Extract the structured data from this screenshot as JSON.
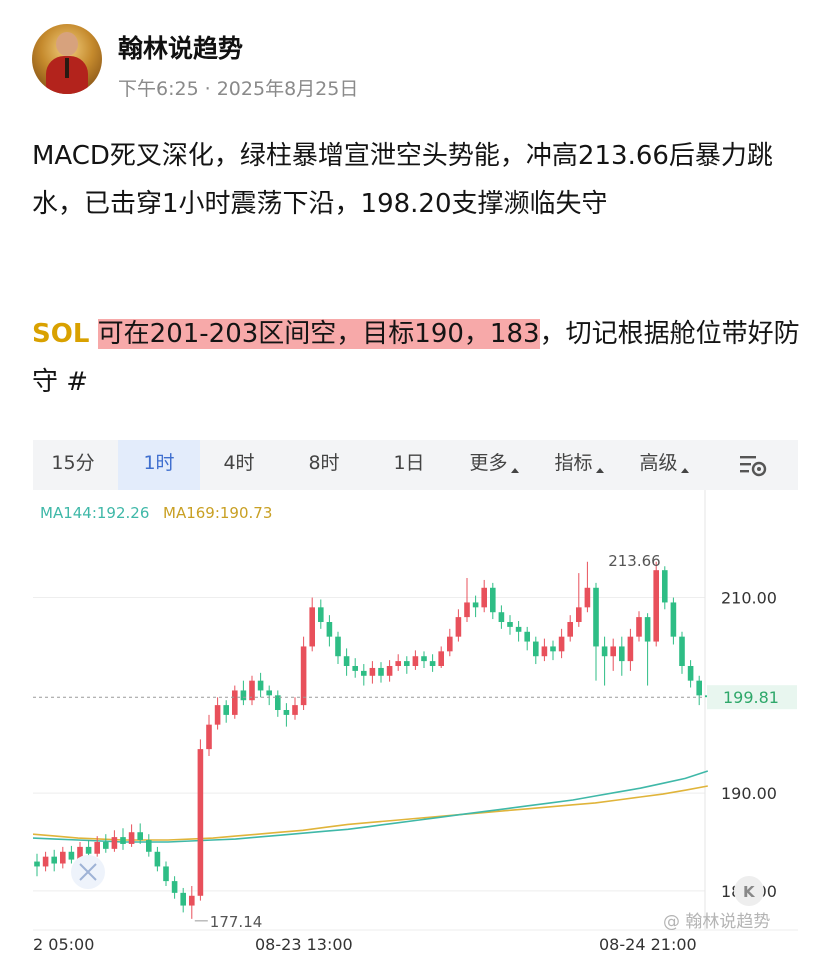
{
  "post": {
    "author": "翰林说趋势",
    "time": "下午6:25",
    "dot": "·",
    "date": "2025年8月25日",
    "paragraph1": "MACD死叉深化，绿柱暴增宣泄空头势能，冲高213.66后暴力跳水，已击穿1小时震荡下沿，198.20支撑濒临失守",
    "symbol": "SOL",
    "highlight": "可在201-203区间空，目标190，183",
    "tail": "，切记根据舱位带好防守 #"
  },
  "chart_tabs": [
    {
      "label": "15分",
      "active": false,
      "dropdown": false
    },
    {
      "label": "1时",
      "active": true,
      "dropdown": false
    },
    {
      "label": "4时",
      "active": false,
      "dropdown": false
    },
    {
      "label": "8时",
      "active": false,
      "dropdown": false
    },
    {
      "label": "1日",
      "active": false,
      "dropdown": false
    },
    {
      "label": "更多",
      "active": false,
      "dropdown": true
    },
    {
      "label": "指标",
      "active": false,
      "dropdown": true
    },
    {
      "label": "高级",
      "active": false,
      "dropdown": true
    }
  ],
  "chart_data": {
    "type": "candlestick",
    "ma_labels": [
      "MA144:192.26",
      "MA169:190.73"
    ],
    "colors": {
      "up": "#e8505b",
      "down": "#2ebd85",
      "ma144": "#3fb8a8",
      "ma169": "#e0b43a"
    },
    "y_ticks": [
      "210.00",
      "190.00",
      "180.00"
    ],
    "y_tick_values": [
      210,
      190,
      180
    ],
    "ylim": [
      176,
      221
    ],
    "current_price": 199.81,
    "current_price_label": "199.81",
    "x_ticks": [
      "2 05:00",
      "08-23 13:00",
      "08-24 21:00"
    ],
    "x_tick_index": [
      2,
      30,
      70
    ],
    "high_label": "213.66",
    "high_index": 72,
    "low_label": "177.14",
    "low_index": 18,
    "candles": [
      [
        183.0,
        182.5,
        183.8,
        181.5
      ],
      [
        182.5,
        183.5,
        184.0,
        182.0
      ],
      [
        183.5,
        182.8,
        184.2,
        182.0
      ],
      [
        182.8,
        184.0,
        184.5,
        182.3
      ],
      [
        184.0,
        183.2,
        184.6,
        182.8
      ],
      [
        183.2,
        184.5,
        185.0,
        182.9
      ],
      [
        184.5,
        183.8,
        185.2,
        183.2
      ],
      [
        183.8,
        185.0,
        185.6,
        183.5
      ],
      [
        185.0,
        184.3,
        185.8,
        183.9
      ],
      [
        184.3,
        185.5,
        186.2,
        184.0
      ],
      [
        185.5,
        184.8,
        186.4,
        184.2
      ],
      [
        184.8,
        186.0,
        186.8,
        184.5
      ],
      [
        186.0,
        185.2,
        186.9,
        184.8
      ],
      [
        185.2,
        184.0,
        185.8,
        183.5
      ],
      [
        184.0,
        182.5,
        184.5,
        182.0
      ],
      [
        182.5,
        181.0,
        183.0,
        180.5
      ],
      [
        181.0,
        179.8,
        181.5,
        179.2
      ],
      [
        179.8,
        178.5,
        180.3,
        177.8
      ],
      [
        178.5,
        179.5,
        180.5,
        177.14
      ],
      [
        179.5,
        194.5,
        195.5,
        179.0
      ],
      [
        194.5,
        197.0,
        198.0,
        193.8
      ],
      [
        197.0,
        199.0,
        199.8,
        196.5
      ],
      [
        199.0,
        198.0,
        199.5,
        197.2
      ],
      [
        198.0,
        200.5,
        201.0,
        197.6
      ],
      [
        200.5,
        199.5,
        201.5,
        199.0
      ],
      [
        199.5,
        201.5,
        202.0,
        199.0
      ],
      [
        201.5,
        200.5,
        202.3,
        199.8
      ],
      [
        200.5,
        200.0,
        201.0,
        199.0
      ],
      [
        200.0,
        198.5,
        200.5,
        197.8
      ],
      [
        198.5,
        198.0,
        199.2,
        196.8
      ],
      [
        198.0,
        199.0,
        199.8,
        197.5
      ],
      [
        199.0,
        205.0,
        206.0,
        198.5
      ],
      [
        205.0,
        209.0,
        210.0,
        204.5
      ],
      [
        209.0,
        207.5,
        209.8,
        206.8
      ],
      [
        207.5,
        206.0,
        208.2,
        205.0
      ],
      [
        206.0,
        204.0,
        206.5,
        203.2
      ],
      [
        204.0,
        203.0,
        204.8,
        202.0
      ],
      [
        203.0,
        202.5,
        203.8,
        201.8
      ],
      [
        202.5,
        202.0,
        203.2,
        201.0
      ],
      [
        202.0,
        202.8,
        203.5,
        201.2
      ],
      [
        202.8,
        202.0,
        203.4,
        201.3
      ],
      [
        202.0,
        203.0,
        203.6,
        201.4
      ],
      [
        203.0,
        203.5,
        204.2,
        202.5
      ],
      [
        203.5,
        203.0,
        204.0,
        202.2
      ],
      [
        203.0,
        204.0,
        204.6,
        202.6
      ],
      [
        204.0,
        203.5,
        204.5,
        202.8
      ],
      [
        203.5,
        203.0,
        204.2,
        202.4
      ],
      [
        203.0,
        204.5,
        205.0,
        202.8
      ],
      [
        204.5,
        206.0,
        206.8,
        204.0
      ],
      [
        206.0,
        208.0,
        208.8,
        205.5
      ],
      [
        208.0,
        209.5,
        212.0,
        207.5
      ],
      [
        209.5,
        209.0,
        210.2,
        208.0
      ],
      [
        209.0,
        211.0,
        211.8,
        208.5
      ],
      [
        211.0,
        208.5,
        211.5,
        207.8
      ],
      [
        208.5,
        207.5,
        209.2,
        206.8
      ],
      [
        207.5,
        207.0,
        208.2,
        206.2
      ],
      [
        207.0,
        206.5,
        207.6,
        205.5
      ],
      [
        206.5,
        205.5,
        207.0,
        204.6
      ],
      [
        205.5,
        204.0,
        206.0,
        203.2
      ],
      [
        204.0,
        205.0,
        205.8,
        203.5
      ],
      [
        205.0,
        204.5,
        205.6,
        203.6
      ],
      [
        204.5,
        206.0,
        206.8,
        203.8
      ],
      [
        206.0,
        207.5,
        208.2,
        205.5
      ],
      [
        207.5,
        209.0,
        212.5,
        207.0
      ],
      [
        209.0,
        211.0,
        213.66,
        208.5
      ],
      [
        211.0,
        205.0,
        211.5,
        201.5
      ],
      [
        205.0,
        204.0,
        206.0,
        201.0
      ],
      [
        204.0,
        205.0,
        205.8,
        202.5
      ],
      [
        205.0,
        203.5,
        206.0,
        202.0
      ],
      [
        203.5,
        206.0,
        206.8,
        202.5
      ],
      [
        206.0,
        208.0,
        208.6,
        205.5
      ],
      [
        208.0,
        205.5,
        208.4,
        201.0
      ],
      [
        205.5,
        212.8,
        213.66,
        205.0
      ],
      [
        212.8,
        209.5,
        213.2,
        208.8
      ],
      [
        209.5,
        206.0,
        210.0,
        205.2
      ],
      [
        206.0,
        203.0,
        206.5,
        202.2
      ],
      [
        203.0,
        201.5,
        203.6,
        200.8
      ],
      [
        201.5,
        200.0,
        202.0,
        199.0
      ],
      [
        200.0,
        199.81,
        200.6,
        198.6
      ]
    ],
    "ma144": [
      185.4,
      185.3,
      185.2,
      185.1,
      185.0,
      185.0,
      185.0,
      185.1,
      185.2,
      185.3,
      185.5,
      185.7,
      185.9,
      186.1,
      186.3,
      186.6,
      186.9,
      187.2,
      187.5,
      187.8,
      188.1,
      188.4,
      188.7,
      189.0,
      189.3,
      189.7,
      190.1,
      190.5,
      191.0,
      191.5,
      192.26
    ],
    "ma169": [
      185.8,
      185.6,
      185.4,
      185.3,
      185.2,
      185.2,
      185.2,
      185.3,
      185.4,
      185.6,
      185.8,
      186.0,
      186.2,
      186.5,
      186.8,
      187.0,
      187.2,
      187.4,
      187.6,
      187.8,
      188.0,
      188.2,
      188.4,
      188.6,
      188.8,
      189.0,
      189.3,
      189.6,
      189.9,
      190.3,
      190.73
    ],
    "watermark": "翰林说趋势",
    "grid": true
  }
}
